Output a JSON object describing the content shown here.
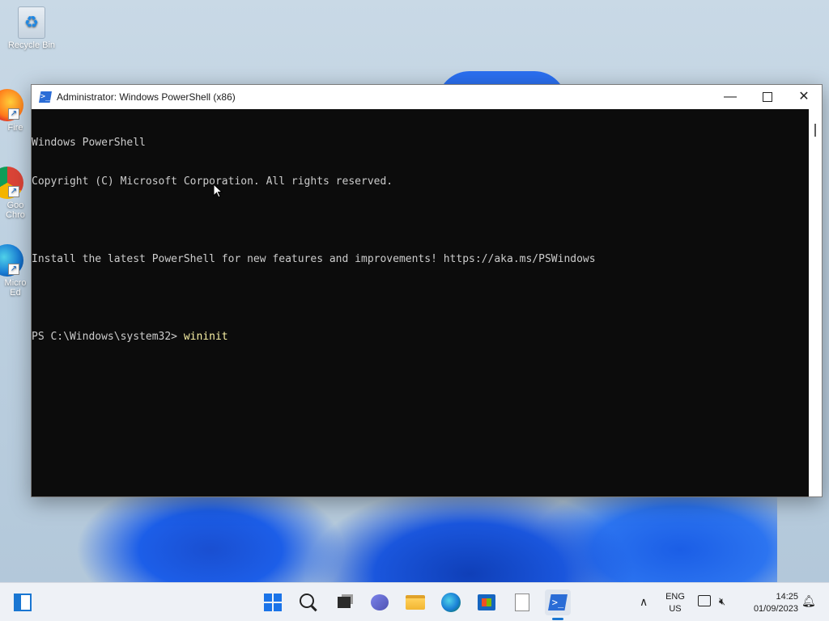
{
  "desktop": {
    "icons": [
      {
        "label": "Recycle Bin"
      },
      {
        "label": "Fire"
      },
      {
        "label": "Goo\nChro"
      },
      {
        "label": "Micro\nEd"
      }
    ]
  },
  "window": {
    "title": "Administrator: Windows PowerShell (x86)",
    "minimize_glyph": "—",
    "close_glyph": "✕",
    "console": {
      "line1": "Windows PowerShell",
      "line2": "Copyright (C) Microsoft Corporation. All rights reserved.",
      "line3": "Install the latest PowerShell for new features and improvements! https://aka.ms/PSWindows",
      "prompt": "PS C:\\Windows\\system32> ",
      "command": "wininit"
    }
  },
  "taskbar": {
    "lang_line1": "ENG",
    "lang_line2": "US",
    "time": "14:25",
    "date": "01/09/2023",
    "chevron": "∧",
    "ps_icon_text": ">_"
  },
  "colors": {
    "console_bg": "#0c0c0c",
    "console_fg": "#cccccc",
    "command_fg": "#f9f1a5",
    "accent": "#1976d2"
  }
}
